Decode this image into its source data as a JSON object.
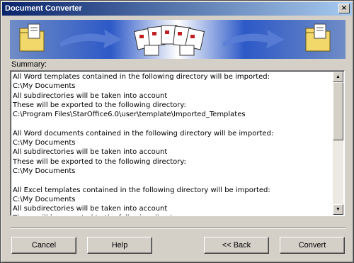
{
  "window": {
    "title": "Document Converter",
    "close_glyph": "×"
  },
  "banner": {
    "icons": [
      "folder-icon",
      "arrow-right-icon",
      "document-stack-icon",
      "arrow-right-icon",
      "folder-icon"
    ]
  },
  "summary": {
    "label": "Summary:",
    "text": "All Word templates contained in the following directory will be imported:\nC:\\My Documents\nAll subdirectories will be taken into account\nThese will be exported to the following directory:\nC:\\Program Files\\StarOffice6.0\\user\\template\\Imported_Templates\n\nAll Word documents contained in the following directory will be imported:\nC:\\My Documents\nAll subdirectories will be taken into account\nThese will be exported to the following directory:\nC:\\My Documents\n\nAll Excel templates contained in the following directory will be imported:\nC:\\My Documents\nAll subdirectories will be taken into account\nThese will be exported to the following directory:"
  },
  "scrollbar": {
    "up_glyph": "▲",
    "down_glyph": "▼"
  },
  "buttons": {
    "cancel": "Cancel",
    "help": "Help",
    "back": "<< Back",
    "convert": "Convert"
  },
  "colors": {
    "title_start": "#0a246a",
    "title_end": "#a6caf0",
    "face": "#d4d0c8",
    "banner_blue": "#2d59c7"
  }
}
